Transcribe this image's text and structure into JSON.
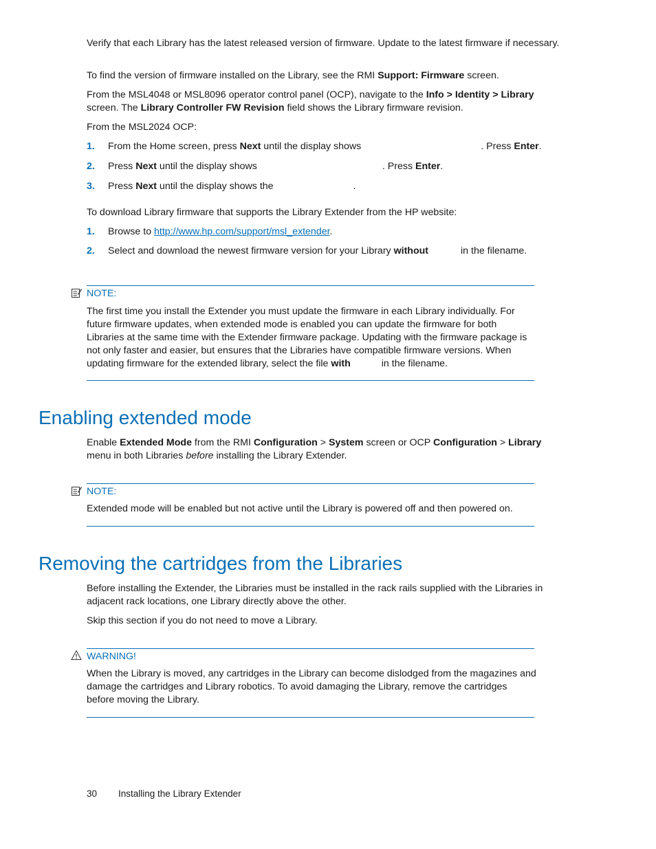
{
  "intro": {
    "p1": "Verify that each Library has the latest released version of firmware. Update to the latest firmware if necessary.",
    "p2_pre": "To find the version of firmware installed on the Library, see the RMI ",
    "p2_bold": "Support: Firmware",
    "p2_post": " screen.",
    "p3_pre": "From the MSL4048 or MSL8096 operator control panel (OCP), navigate to the ",
    "p3_bold1": "Info > Identity > Library",
    "p3_mid": " screen. The ",
    "p3_bold2": "Library Controller FW Revision",
    "p3_post": " field shows the Library firmware revision.",
    "p4": "From the MSL2024 OCP:"
  },
  "ocp_steps": [
    {
      "num": "1.",
      "pre": "From the Home screen, press ",
      "bold": "Next",
      "mid": " until the display shows",
      "post": ". Press ",
      "bold2": "Enter",
      "end": "."
    },
    {
      "num": "2.",
      "pre": "Press ",
      "bold": "Next",
      "mid": " until the display shows",
      "post": ". Press ",
      "bold2": "Enter",
      "end": "."
    },
    {
      "num": "3.",
      "pre": "Press ",
      "bold": "Next",
      "mid": " until the display shows the",
      "post": ".",
      "bold2": "",
      "end": ""
    }
  ],
  "download": {
    "intro": "To download Library firmware that supports the Library Extender from the HP website:",
    "steps": [
      {
        "num": "1.",
        "pre": "Browse to ",
        "link": "http://www.hp.com/support/msl_extender",
        "post": "."
      },
      {
        "num": "2.",
        "pre": "Select and download the newest firmware version for your Library ",
        "bold": "without",
        "post": "in the filename."
      }
    ]
  },
  "note1": {
    "label": "NOTE:",
    "text_pre": "The first time you install the Extender you must update the firmware in each Library individually. For future firmware updates, when extended mode is enabled you can update the firmware for both Libraries at the same time with the Extender firmware package. Updating with the firmware package is not only faster and easier, but ensures that the Libraries have compatible firmware versions. When updating firmware for the extended library, select the file ",
    "text_bold": "with",
    "text_post": "in the filename."
  },
  "section1": {
    "heading": "Enabling extended mode",
    "p_pre": "Enable ",
    "b1": "Extended Mode",
    "m1": " from the RMI ",
    "b2": "Configuration",
    "m2": " > ",
    "b3": "System",
    "m3": " screen or OCP ",
    "b4": "Configuration",
    "m4": " > ",
    "b5": "Library",
    "m5": " menu in both Libraries ",
    "i1": "before",
    "post": " installing the Library Extender."
  },
  "note2": {
    "label": "NOTE:",
    "text": "Extended mode will be enabled but not active until the Library is powered off and then powered on."
  },
  "section2": {
    "heading": "Removing the cartridges from the Libraries",
    "p1": "Before installing the Extender, the Libraries must be installed in the rack rails supplied with the Libraries in adjacent rack locations, one Library directly above the other.",
    "p2": "Skip this section if you do not need to move a Library."
  },
  "warning": {
    "label": "WARNING!",
    "text": "When the Library is moved, any cartridges in the Library can become dislodged from the magazines and damage the cartridges and Library robotics. To avoid damaging the Library, remove the cartridges before moving the Library."
  },
  "footer": {
    "page_number": "30",
    "chapter": "Installing the Library Extender"
  }
}
